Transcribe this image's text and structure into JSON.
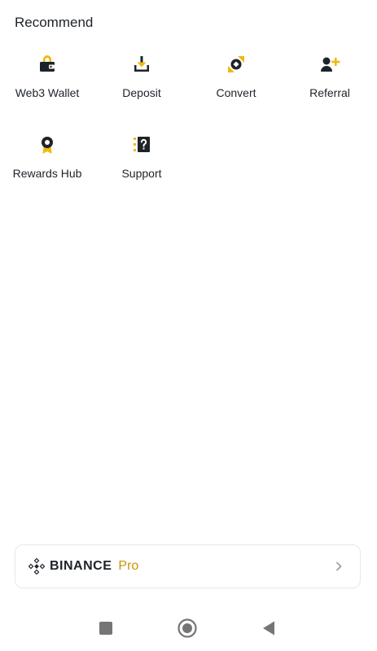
{
  "section": {
    "title": "Recommend"
  },
  "items": [
    {
      "label": "Web3 Wallet",
      "icon": "wallet-icon"
    },
    {
      "label": "Deposit",
      "icon": "deposit-icon"
    },
    {
      "label": "Convert",
      "icon": "convert-icon"
    },
    {
      "label": "Referral",
      "icon": "referral-icon"
    },
    {
      "label": "Rewards Hub",
      "icon": "rewards-medal-icon"
    },
    {
      "label": "Support",
      "icon": "support-question-icon"
    }
  ],
  "promo": {
    "brand": "BINANCE",
    "suffix": "Pro",
    "icon": "binance-logo-icon",
    "chevron": "chevron-right-icon"
  },
  "navigation": {
    "recent": "recent-apps-square-icon",
    "home": "home-circle-icon",
    "back": "back-triangle-icon"
  },
  "colors": {
    "accent": "#F0B90B",
    "pro_text": "#C99400",
    "text": "#1E2329",
    "icon_dark": "#1E2329",
    "border": "#E6E8EA",
    "nav_icon": "#757575"
  }
}
